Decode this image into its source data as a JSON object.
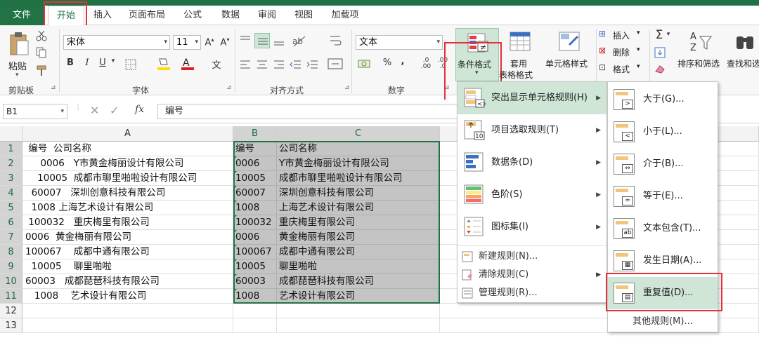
{
  "menu_tabs": [
    "文件",
    "开始",
    "插入",
    "页面布局",
    "公式",
    "数据",
    "审阅",
    "视图",
    "加载项"
  ],
  "ribbon": {
    "paste_label": "粘贴",
    "clipboard_group": "剪贴板",
    "font_name": "宋体",
    "font_size": "11",
    "font_group": "字体",
    "align_group": "对齐方式",
    "number_format": "文本",
    "number_group": "数字",
    "cond_format_label": "条件格式",
    "table_format_label_1": "套用",
    "table_format_label_2": "表格格式",
    "cell_style_label": "单元格样式",
    "insert_label": "插入",
    "delete_label": "删除",
    "format_label": "格式",
    "sort_filter_label": "排序和筛选",
    "find_select_label": "查找和选"
  },
  "formula_bar": {
    "name_box": "B1",
    "fx": "fx",
    "content": "编号"
  },
  "columns": [
    "A",
    "B",
    "C"
  ],
  "rows": [
    {
      "n": "1",
      "a": " 编号  公司名称",
      "b": "编号",
      "c": "公司名称"
    },
    {
      "n": "2",
      "a": "     0006   Y市黄金梅丽设计有限公司",
      "b": "0006",
      "c": "Y市黄金梅丽设计有限公司"
    },
    {
      "n": "3",
      "a": "    10005  成都市聊里啪啦设计有限公司",
      "b": "10005",
      "c": "成都市聊里啪啦设计有限公司"
    },
    {
      "n": "4",
      "a": "  60007   深圳创意科技有限公司",
      "b": "60007",
      "c": "深圳创意科技有限公司"
    },
    {
      "n": "5",
      "a": "  1008 上海艺术设计有限公司",
      "b": "1008",
      "c": "上海艺术设计有限公司"
    },
    {
      "n": "6",
      "a": " 100032   重庆梅里有限公司",
      "b": "100032",
      "c": "重庆梅里有限公司"
    },
    {
      "n": "7",
      "a": "0006  黄金梅丽有限公司",
      "b": "0006",
      "c": "黄金梅丽有限公司"
    },
    {
      "n": "8",
      "a": "100067    成都中通有限公司",
      "b": "100067",
      "c": "成都中通有限公司"
    },
    {
      "n": "9",
      "a": "  10005    聊里啪啦",
      "b": "10005",
      "c": "聊里啪啦"
    },
    {
      "n": "10",
      "a": "60003   成都琵琶科技有限公司",
      "b": "60003",
      "c": "成都琵琶科技有限公司"
    },
    {
      "n": "11",
      "a": "   1008    艺术设计有限公司",
      "b": "1008",
      "c": "艺术设计有限公司"
    },
    {
      "n": "12",
      "a": "",
      "b": "",
      "c": ""
    },
    {
      "n": "13",
      "a": "",
      "b": "",
      "c": ""
    }
  ],
  "cf_menu": {
    "items": [
      "突出显示单元格规则(H)",
      "项目选取规则(T)",
      "数据条(D)",
      "色阶(S)",
      "图标集(I)"
    ],
    "commands": [
      "新建规则(N)...",
      "清除规则(C)",
      "管理规则(R)..."
    ]
  },
  "sub_menu": {
    "items": [
      "大于(G)...",
      "小于(L)...",
      "介于(B)...",
      "等于(E)...",
      "文本包含(T)...",
      "发生日期(A)...",
      "重复值(D)..."
    ],
    "more": "其他规则(M)..."
  },
  "colors": {
    "accent": "#217346",
    "highlight": "#cfe6d7",
    "annotation_red": "#e5303b"
  }
}
